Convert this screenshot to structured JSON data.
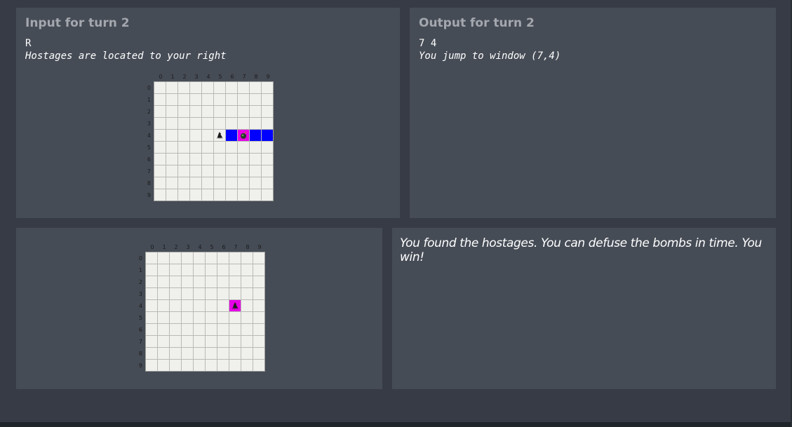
{
  "input_panel": {
    "title": "Input for turn 2",
    "line1": "R",
    "line2": "Hostages are located to your right"
  },
  "output_panel": {
    "title": "Output for turn 2",
    "line1": "7 4",
    "line2": "You jump to window (7,4)"
  },
  "result": {
    "text": "You found the hostages. You can defuse the bombs in time. You win!"
  },
  "grid_labels": [
    "0",
    "1",
    "2",
    "3",
    "4",
    "5",
    "6",
    "7",
    "8",
    "9"
  ],
  "board_before": {
    "batman_col": 5,
    "batman_row": 4,
    "highlight_row": 4,
    "highlight_from_col": 6,
    "highlight_to_col": 9,
    "bomb_col": 7,
    "bomb_row": 4,
    "colors": {
      "highlight": "#0000ff",
      "bomb_cell": "#e600e6"
    }
  },
  "board_after": {
    "batman_col": 7,
    "batman_row": 4,
    "colors": {
      "bomb_cell": "#e600e6"
    }
  },
  "icons": {
    "hero": "batman-icon",
    "bomb": "bomb-icon"
  }
}
